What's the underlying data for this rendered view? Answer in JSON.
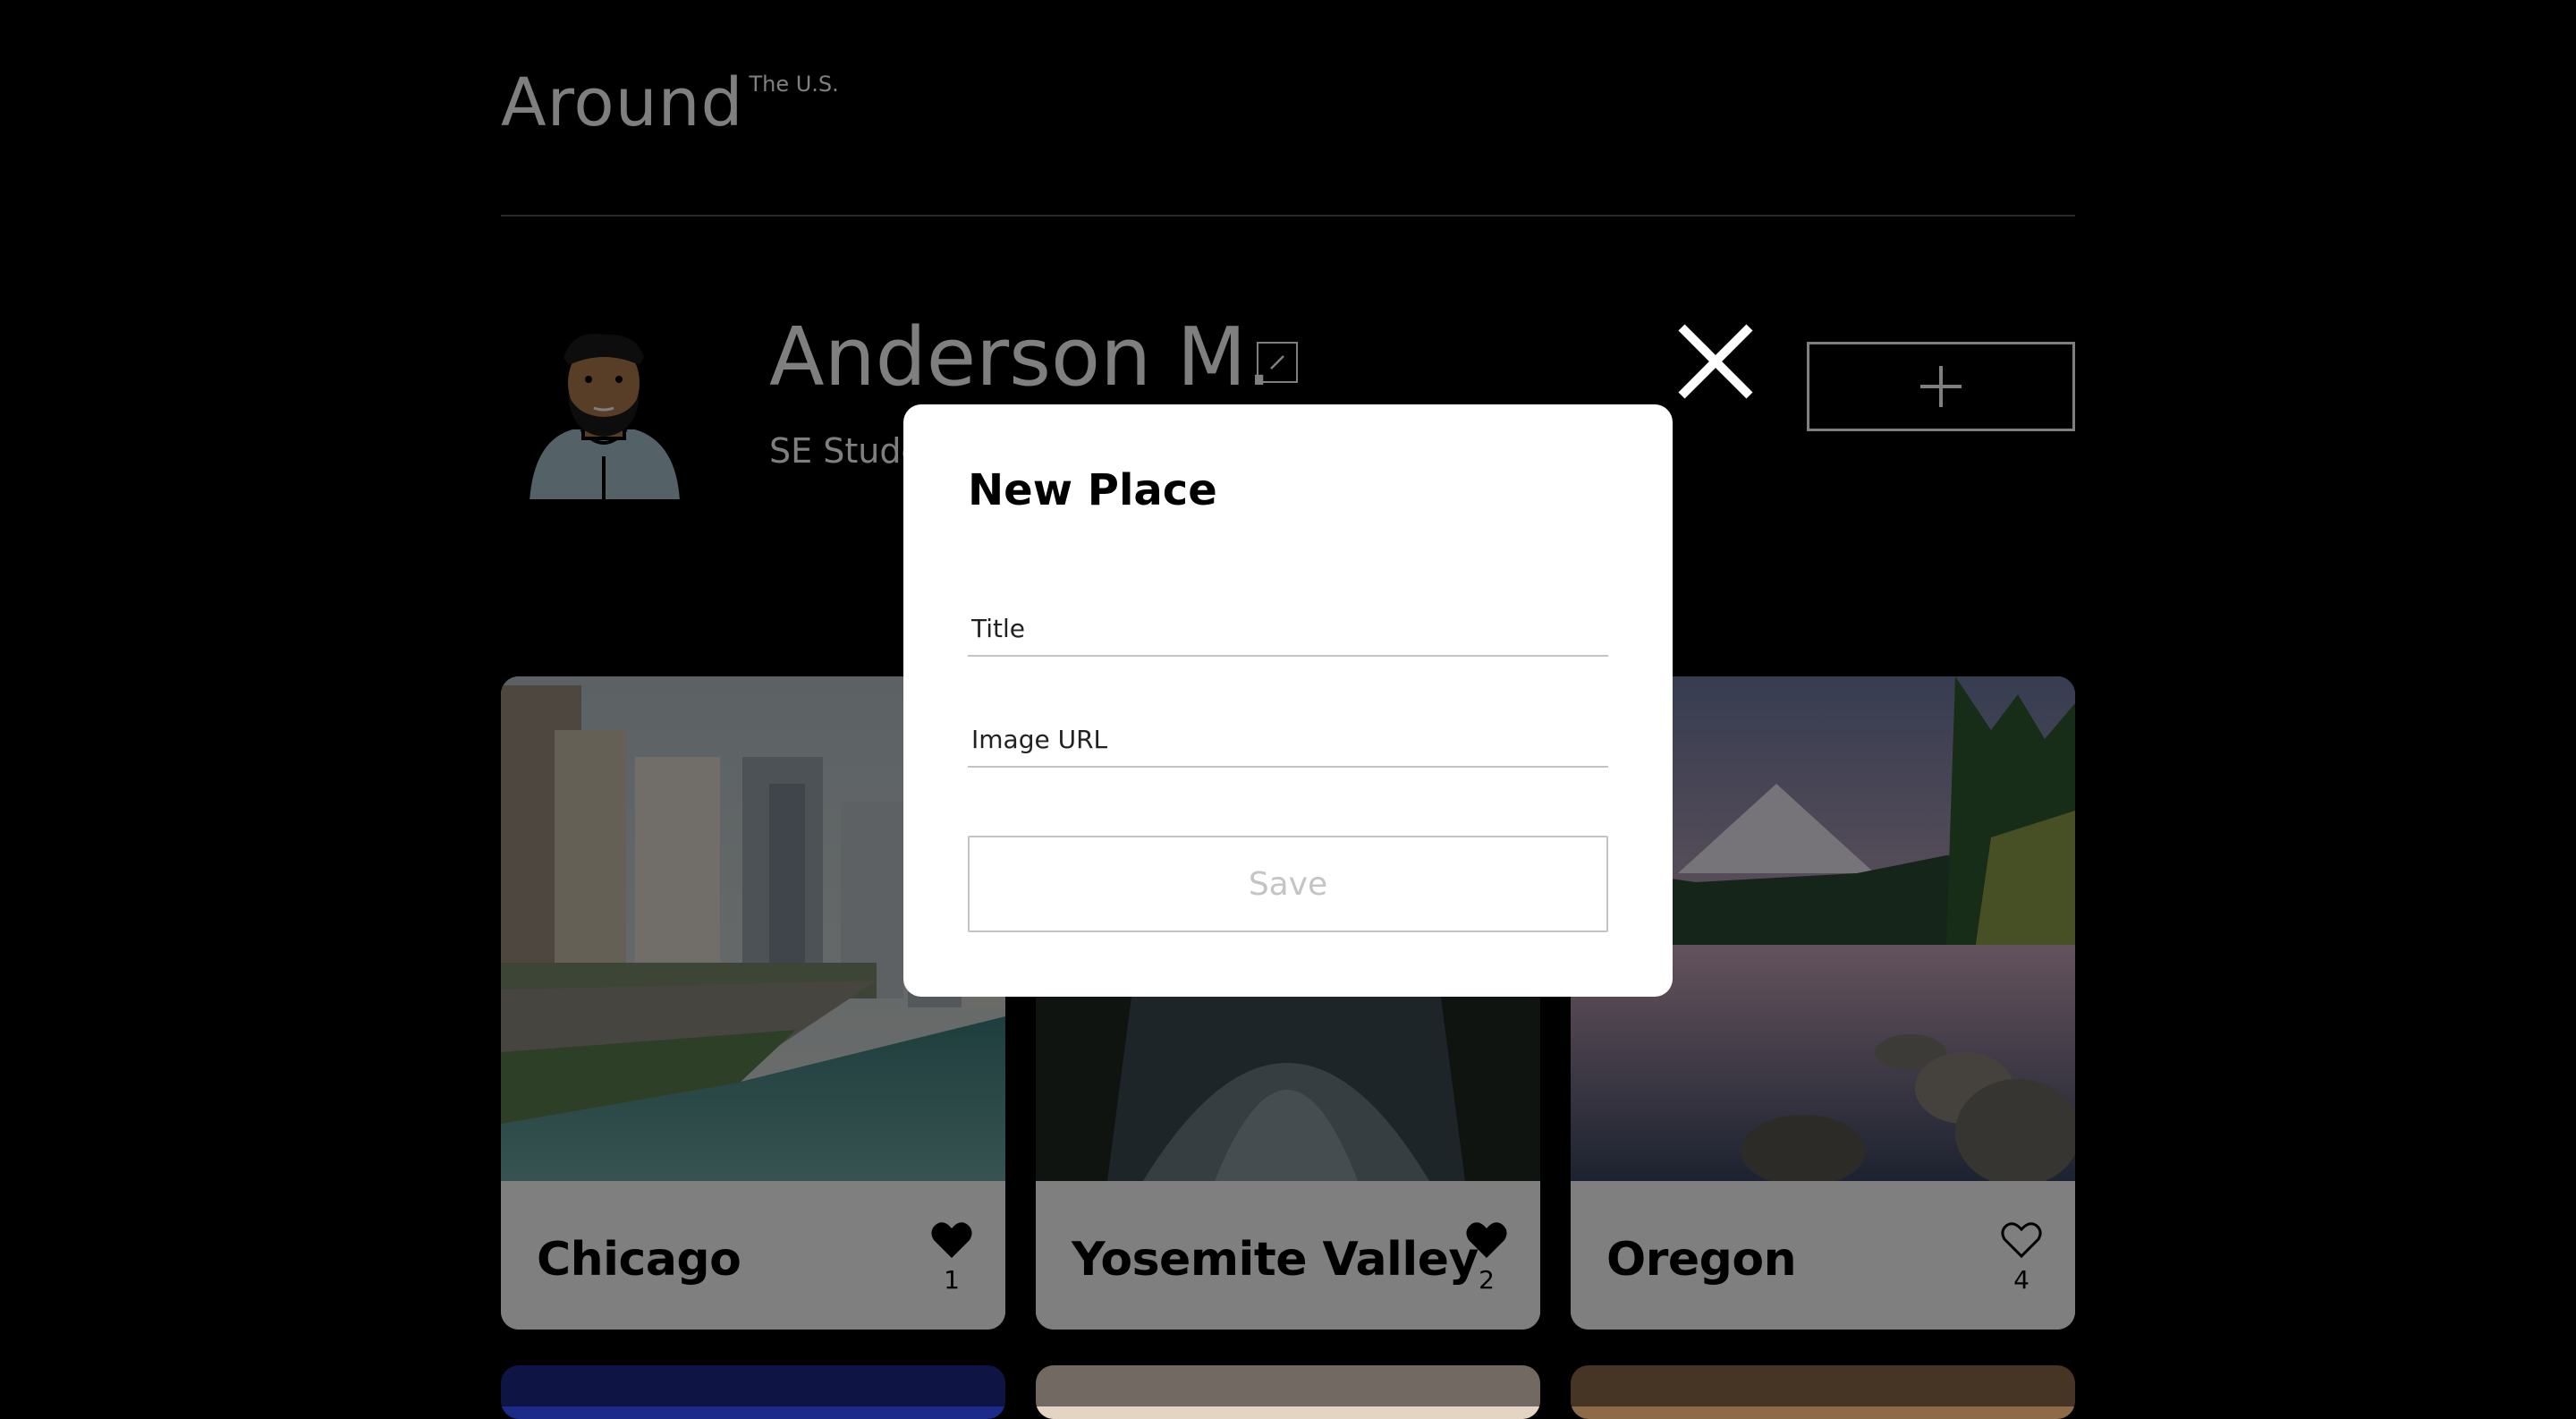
{
  "header": {
    "logo_main": "Around",
    "logo_sup": "The U.S."
  },
  "profile": {
    "name": "Anderson M.",
    "about": "SE Student"
  },
  "cards": [
    {
      "title": "Chicago",
      "likes": "1",
      "liked": true
    },
    {
      "title": "Yosemite Valley",
      "likes": "2",
      "liked": true
    },
    {
      "title": "Oregon",
      "likes": "4",
      "liked": false
    }
  ],
  "modal": {
    "title": "New Place",
    "title_placeholder": "Title",
    "url_placeholder": "Image URL",
    "save_label": "Save"
  },
  "colors": {
    "background": "#000000",
    "modal_bg": "#ffffff",
    "input_border": "#c4c4c4"
  }
}
